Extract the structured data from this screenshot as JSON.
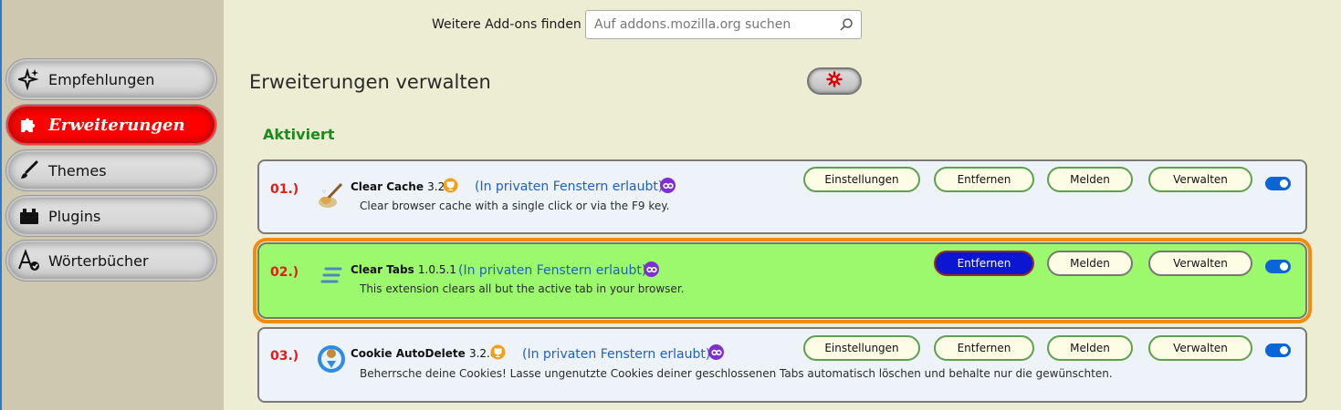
{
  "sidebar": {
    "items": [
      {
        "label": "Empfehlungen",
        "icon": "sparkle-icon"
      },
      {
        "label": "Erweiterungen",
        "icon": "puzzle-icon",
        "active": true
      },
      {
        "label": "Themes",
        "icon": "brush-icon"
      },
      {
        "label": "Plugins",
        "icon": "plugin-icon"
      },
      {
        "label": "Wörterbücher",
        "icon": "dictionary-icon"
      }
    ]
  },
  "header": {
    "find_label": "Weitere Add-ons finden",
    "search_placeholder": "Auf addons.mozilla.org suchen"
  },
  "main": {
    "title": "Erweiterungen verwalten",
    "section": "Aktiviert",
    "extensions": [
      {
        "num": "01.)",
        "name": "Clear Cache",
        "version": "3.2",
        "private": "(In privaten Fenstern erlaubt)",
        "description": "Clear browser cache with a single click or via the F9 key.",
        "buttons": [
          "Einstellungen",
          "Entfernen",
          "Melden",
          "Verwalten"
        ],
        "enabled": true
      },
      {
        "num": "02.)",
        "name": "Clear Tabs",
        "version": "1.0.5.1",
        "private": "(In privaten Fenstern erlaubt)",
        "description": "This extension clears all but the active tab in your browser.",
        "buttons": [
          "Entfernen",
          "Melden",
          "Verwalten"
        ],
        "enabled": true
      },
      {
        "num": "03.)",
        "name": "Cookie AutoDelete",
        "version": "3.2.0",
        "private": "(In privaten Fenstern erlaubt)",
        "description": "Beherrsche deine Cookies! Lasse ungenutzte Cookies deiner geschlossenen Tabs automatisch löschen und behalte nur die gewünschten.",
        "buttons": [
          "Einstellungen",
          "Entfernen",
          "Melden",
          "Verwalten"
        ],
        "enabled": true
      }
    ]
  },
  "colors": {
    "accent_red": "#ff0000",
    "highlight_card": "#9cf86d",
    "highlight_outline": "#f38a11",
    "toggle_on": "#0b65d6"
  }
}
